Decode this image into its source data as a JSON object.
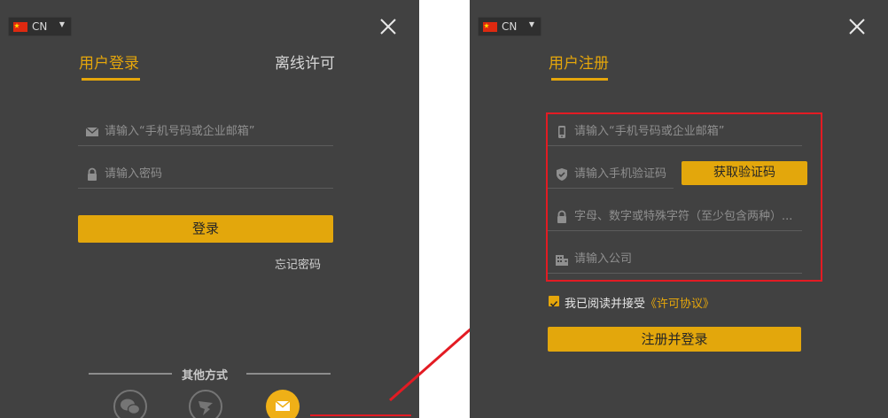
{
  "colors": {
    "panel_bg": "#414141",
    "accent": "#e5a60b",
    "highlight": "#e31b23"
  },
  "login": {
    "lang_code": "CN",
    "tabs": [
      {
        "label": "用户登录",
        "active": true
      },
      {
        "label": "离线许可",
        "active": false
      }
    ],
    "account_placeholder": "请输入“手机号码或企业邮箱”",
    "password_placeholder": "请输入密码",
    "login_button": "登录",
    "forgot_password": "忘记密码",
    "other_methods_label": "其他方式",
    "social_icons": [
      "wechat-icon",
      "dingtalk-icon",
      "email-icon"
    ]
  },
  "register": {
    "lang_code": "CN",
    "tab_label": "用户注册",
    "phone_placeholder": "请输入“手机号码或企业邮箱”",
    "code_placeholder": "请输入手机验证码",
    "get_code_button": "获取验证码",
    "password_placeholder": "字母、数字或特殊字符（至少包含两种）...",
    "company_placeholder": "请输入公司",
    "agree_prefix": "我已阅读并接受",
    "agree_link": "《许可协议》",
    "agreed": true,
    "submit_button": "注册并登录"
  }
}
